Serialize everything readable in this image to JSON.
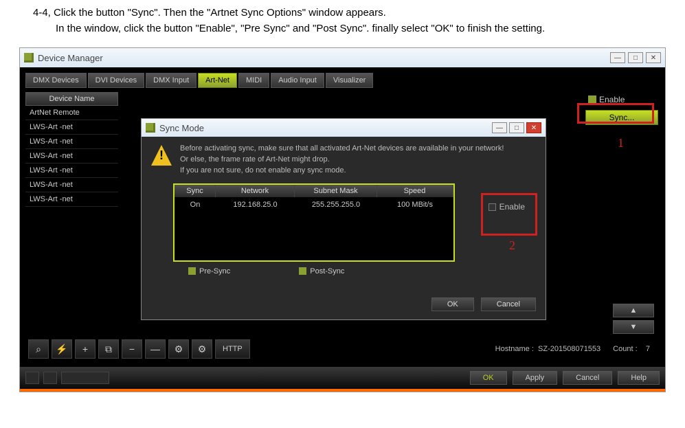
{
  "instructions": {
    "line1": "4-4, Click the button \"Sync\". Then the \"Artnet Sync Options\" window appears.",
    "line2": "In the window, click the button \"Enable\", \"Pre Sync\" and \"Post Sync\". finally select \"OK\" to finish the setting."
  },
  "window": {
    "title": "Device Manager",
    "minimize": "—",
    "maximize": "□",
    "close": "✕"
  },
  "tabs": {
    "dmx_devices": "DMX Devices",
    "dvi_devices": "DVI Devices",
    "dmx_input": "DMX Input",
    "art_net": "Art-Net",
    "midi": "MIDI",
    "audio_input": "Audio Input",
    "visualizer": "Visualizer"
  },
  "device_list": {
    "header": "Device Name",
    "items": [
      "ArtNet Remote",
      "LWS-Art -net",
      "LWS-Art -net",
      "LWS-Art -net",
      "LWS-Art -net",
      "LWS-Art -net",
      "LWS-Art -net"
    ]
  },
  "right_panel": {
    "enable": "Enable",
    "sync": "Sync..."
  },
  "annotations": {
    "one": "1",
    "two": "2"
  },
  "toolbar": {
    "search": "⌕",
    "bolt": "⚡",
    "plus": "+",
    "minus": "−",
    "copy": "⧉",
    "del": "—",
    "gear1": "⚙",
    "gear2": "⚙",
    "http": "HTTP"
  },
  "status": {
    "hostname_label": "Hostname :",
    "hostname_value": "SZ-201508071553",
    "count_label": "Count :",
    "count_value": "7"
  },
  "arrows": {
    "up": "▲",
    "down": "▼"
  },
  "footer": {
    "ok": "OK",
    "apply": "Apply",
    "cancel": "Cancel",
    "help": "Help"
  },
  "modal": {
    "title": "Sync Mode",
    "minimize": "—",
    "maximize": "□",
    "close": "✕",
    "warning": {
      "l1": "Before activating sync, make sure that all activated Art-Net devices are available in your network!",
      "l2": "Or else, the frame rate of Art-Net might drop.",
      "l3": "If you are not sure, do not enable any sync mode."
    },
    "table": {
      "h1": "Sync",
      "h2": "Network",
      "h3": "Subnet Mask",
      "h4": "Speed",
      "r1c1": "On",
      "r1c2": "192.168.25.0",
      "r1c3": "255.255.255.0",
      "r1c4": "100 MBit/s"
    },
    "enable": "Enable",
    "pre_sync": "Pre-Sync",
    "post_sync": "Post-Sync",
    "ok": "OK",
    "cancel": "Cancel"
  }
}
